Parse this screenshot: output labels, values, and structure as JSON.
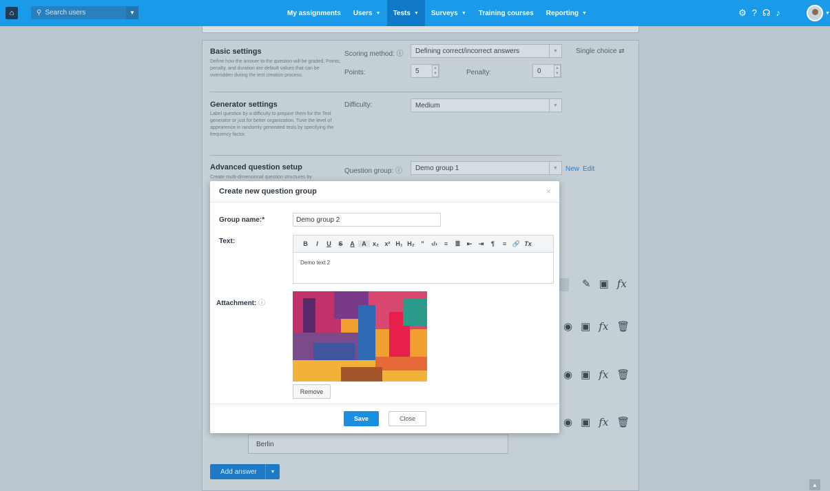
{
  "topbar": {
    "search_placeholder": "Search users",
    "nav": [
      {
        "label": "My assignments",
        "caret": false
      },
      {
        "label": "Users",
        "caret": true
      },
      {
        "label": "Tests",
        "caret": true,
        "active": true
      },
      {
        "label": "Surveys",
        "caret": true
      },
      {
        "label": "Training courses",
        "caret": false
      },
      {
        "label": "Reporting",
        "caret": true
      }
    ],
    "icons": [
      "gear-icon",
      "help-icon",
      "headset-icon",
      "bell-icon"
    ],
    "accent": "#1a9be9"
  },
  "basic": {
    "title": "Basic settings",
    "desc": "Define how the answer to the question will be graded. Points, penalty, and duration are default values that can be overridden during the test creation process.",
    "scoring_label": "Scoring method:",
    "scoring_value": "Defining correct/incorrect answers",
    "type_label": "Single choice",
    "points_label": "Points:",
    "points_value": "5",
    "penalty_label": "Penalty:",
    "penalty_value": "0"
  },
  "generator": {
    "title": "Generator settings",
    "desc": "Label question by a difficulty to prepare them for the Test generator or just for better organization. Tune the level of appearence in randomly generated tests by specifying the frequency factor.",
    "difficulty_label": "Difficulty:",
    "difficulty_value": "Medium"
  },
  "advanced": {
    "title": "Advanced question setup",
    "desc": "Create multi-dimensional question structures by",
    "group_label": "Question group:",
    "group_value": "Demo group 1",
    "new_link": "New",
    "edit_link": "Edit"
  },
  "answer": {
    "value": "Berlin",
    "add_label": "Add answer"
  },
  "modal": {
    "title": "Create new question group",
    "close_glyph": "×",
    "group_name_label": "Group name:*",
    "group_name_value": "Demo group 2",
    "text_label": "Text:",
    "text_value": "Demo text 2",
    "attachment_label": "Attachment:",
    "remove_label": "Remove",
    "save_label": "Save",
    "close_label": "Close",
    "toolbar": [
      "B",
      "I",
      "U",
      "S",
      "A",
      "A",
      "x₂",
      "x²",
      "H₁",
      "H₂",
      "”",
      "‹/›",
      "≡",
      "≣",
      "⇤",
      "⇥",
      "¶",
      "≡",
      "🔗",
      "Tx"
    ]
  }
}
